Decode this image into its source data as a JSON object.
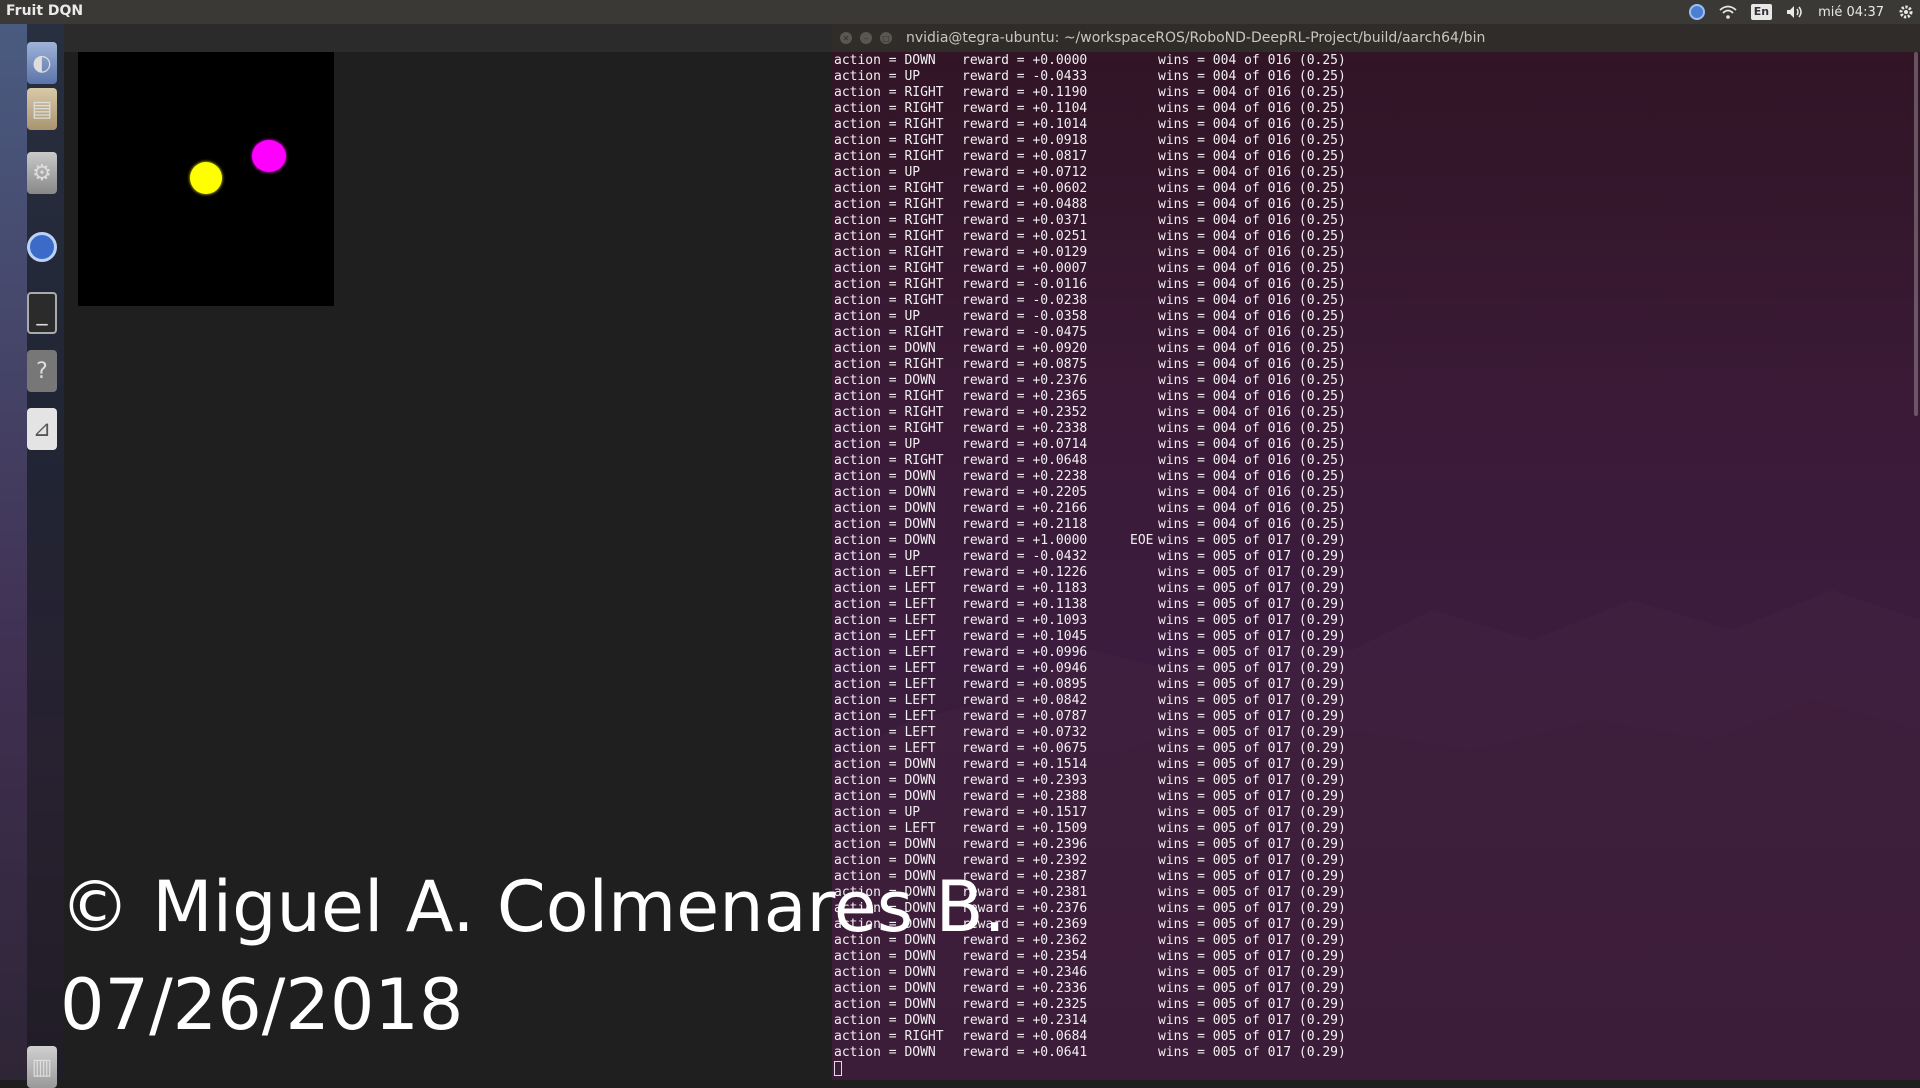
{
  "topbar": {
    "app_title": "Fruit DQN",
    "keyboard_layout": "En",
    "clock": "mié 04:37",
    "icons": [
      "chrome-indicator-icon",
      "wifi-icon",
      "keyboard-layout-icon",
      "volume-icon",
      "gear-icon"
    ]
  },
  "launcher": {
    "icons": [
      "top-launcher-icon",
      "files-icon",
      "settings-icon",
      "chromium-icon",
      "terminal-icon",
      "help-icon",
      "chart-app-icon",
      "trash-icon"
    ]
  },
  "game": {
    "fruit_color": "#ffff00",
    "agent_color": "#ff00ff",
    "background": "#000000"
  },
  "terminal": {
    "title": "nvidia@tegra-ubuntu: ~/workspaceROS/RoboND-DeepRL-Project/build/aarch64/bin",
    "rows": [
      {
        "action": "action = DOWN",
        "reward": "reward = +0.0000",
        "eoe": "",
        "wins": "wins = 004 of 016 (0.25)"
      },
      {
        "action": "action = UP",
        "reward": "reward = -0.0433",
        "eoe": "",
        "wins": "wins = 004 of 016 (0.25)"
      },
      {
        "action": "action = RIGHT",
        "reward": "reward = +0.1190",
        "eoe": "",
        "wins": "wins = 004 of 016 (0.25)"
      },
      {
        "action": "action = RIGHT",
        "reward": "reward = +0.1104",
        "eoe": "",
        "wins": "wins = 004 of 016 (0.25)"
      },
      {
        "action": "action = RIGHT",
        "reward": "reward = +0.1014",
        "eoe": "",
        "wins": "wins = 004 of 016 (0.25)"
      },
      {
        "action": "action = RIGHT",
        "reward": "reward = +0.0918",
        "eoe": "",
        "wins": "wins = 004 of 016 (0.25)"
      },
      {
        "action": "action = RIGHT",
        "reward": "reward = +0.0817",
        "eoe": "",
        "wins": "wins = 004 of 016 (0.25)"
      },
      {
        "action": "action = UP",
        "reward": "reward = +0.0712",
        "eoe": "",
        "wins": "wins = 004 of 016 (0.25)"
      },
      {
        "action": "action = RIGHT",
        "reward": "reward = +0.0602",
        "eoe": "",
        "wins": "wins = 004 of 016 (0.25)"
      },
      {
        "action": "action = RIGHT",
        "reward": "reward = +0.0488",
        "eoe": "",
        "wins": "wins = 004 of 016 (0.25)"
      },
      {
        "action": "action = RIGHT",
        "reward": "reward = +0.0371",
        "eoe": "",
        "wins": "wins = 004 of 016 (0.25)"
      },
      {
        "action": "action = RIGHT",
        "reward": "reward = +0.0251",
        "eoe": "",
        "wins": "wins = 004 of 016 (0.25)"
      },
      {
        "action": "action = RIGHT",
        "reward": "reward = +0.0129",
        "eoe": "",
        "wins": "wins = 004 of 016 (0.25)"
      },
      {
        "action": "action = RIGHT",
        "reward": "reward = +0.0007",
        "eoe": "",
        "wins": "wins = 004 of 016 (0.25)"
      },
      {
        "action": "action = RIGHT",
        "reward": "reward = -0.0116",
        "eoe": "",
        "wins": "wins = 004 of 016 (0.25)"
      },
      {
        "action": "action = RIGHT",
        "reward": "reward = -0.0238",
        "eoe": "",
        "wins": "wins = 004 of 016 (0.25)"
      },
      {
        "action": "action = UP",
        "reward": "reward = -0.0358",
        "eoe": "",
        "wins": "wins = 004 of 016 (0.25)"
      },
      {
        "action": "action = RIGHT",
        "reward": "reward = -0.0475",
        "eoe": "",
        "wins": "wins = 004 of 016 (0.25)"
      },
      {
        "action": "action = DOWN",
        "reward": "reward = +0.0920",
        "eoe": "",
        "wins": "wins = 004 of 016 (0.25)"
      },
      {
        "action": "action = RIGHT",
        "reward": "reward = +0.0875",
        "eoe": "",
        "wins": "wins = 004 of 016 (0.25)"
      },
      {
        "action": "action = DOWN",
        "reward": "reward = +0.2376",
        "eoe": "",
        "wins": "wins = 004 of 016 (0.25)"
      },
      {
        "action": "action = RIGHT",
        "reward": "reward = +0.2365",
        "eoe": "",
        "wins": "wins = 004 of 016 (0.25)"
      },
      {
        "action": "action = RIGHT",
        "reward": "reward = +0.2352",
        "eoe": "",
        "wins": "wins = 004 of 016 (0.25)"
      },
      {
        "action": "action = RIGHT",
        "reward": "reward = +0.2338",
        "eoe": "",
        "wins": "wins = 004 of 016 (0.25)"
      },
      {
        "action": "action = UP",
        "reward": "reward = +0.0714",
        "eoe": "",
        "wins": "wins = 004 of 016 (0.25)"
      },
      {
        "action": "action = RIGHT",
        "reward": "reward = +0.0648",
        "eoe": "",
        "wins": "wins = 004 of 016 (0.25)"
      },
      {
        "action": "action = DOWN",
        "reward": "reward = +0.2238",
        "eoe": "",
        "wins": "wins = 004 of 016 (0.25)"
      },
      {
        "action": "action = DOWN",
        "reward": "reward = +0.2205",
        "eoe": "",
        "wins": "wins = 004 of 016 (0.25)"
      },
      {
        "action": "action = DOWN",
        "reward": "reward = +0.2166",
        "eoe": "",
        "wins": "wins = 004 of 016 (0.25)"
      },
      {
        "action": "action = DOWN",
        "reward": "reward = +0.2118",
        "eoe": "",
        "wins": "wins = 004 of 016 (0.25)"
      },
      {
        "action": "action = DOWN",
        "reward": "reward = +1.0000",
        "eoe": "EOE",
        "wins": "wins = 005 of 017 (0.29)"
      },
      {
        "action": "action = UP",
        "reward": "reward = -0.0432",
        "eoe": "",
        "wins": "wins = 005 of 017 (0.29)"
      },
      {
        "action": "action = LEFT",
        "reward": "reward = +0.1226",
        "eoe": "",
        "wins": "wins = 005 of 017 (0.29)"
      },
      {
        "action": "action = LEFT",
        "reward": "reward = +0.1183",
        "eoe": "",
        "wins": "wins = 005 of 017 (0.29)"
      },
      {
        "action": "action = LEFT",
        "reward": "reward = +0.1138",
        "eoe": "",
        "wins": "wins = 005 of 017 (0.29)"
      },
      {
        "action": "action = LEFT",
        "reward": "reward = +0.1093",
        "eoe": "",
        "wins": "wins = 005 of 017 (0.29)"
      },
      {
        "action": "action = LEFT",
        "reward": "reward = +0.1045",
        "eoe": "",
        "wins": "wins = 005 of 017 (0.29)"
      },
      {
        "action": "action = LEFT",
        "reward": "reward = +0.0996",
        "eoe": "",
        "wins": "wins = 005 of 017 (0.29)"
      },
      {
        "action": "action = LEFT",
        "reward": "reward = +0.0946",
        "eoe": "",
        "wins": "wins = 005 of 017 (0.29)"
      },
      {
        "action": "action = LEFT",
        "reward": "reward = +0.0895",
        "eoe": "",
        "wins": "wins = 005 of 017 (0.29)"
      },
      {
        "action": "action = LEFT",
        "reward": "reward = +0.0842",
        "eoe": "",
        "wins": "wins = 005 of 017 (0.29)"
      },
      {
        "action": "action = LEFT",
        "reward": "reward = +0.0787",
        "eoe": "",
        "wins": "wins = 005 of 017 (0.29)"
      },
      {
        "action": "action = LEFT",
        "reward": "reward = +0.0732",
        "eoe": "",
        "wins": "wins = 005 of 017 (0.29)"
      },
      {
        "action": "action = LEFT",
        "reward": "reward = +0.0675",
        "eoe": "",
        "wins": "wins = 005 of 017 (0.29)"
      },
      {
        "action": "action = DOWN",
        "reward": "reward = +0.1514",
        "eoe": "",
        "wins": "wins = 005 of 017 (0.29)"
      },
      {
        "action": "action = DOWN",
        "reward": "reward = +0.2393",
        "eoe": "",
        "wins": "wins = 005 of 017 (0.29)"
      },
      {
        "action": "action = DOWN",
        "reward": "reward = +0.2388",
        "eoe": "",
        "wins": "wins = 005 of 017 (0.29)"
      },
      {
        "action": "action = UP",
        "reward": "reward = +0.1517",
        "eoe": "",
        "wins": "wins = 005 of 017 (0.29)"
      },
      {
        "action": "action = LEFT",
        "reward": "reward = +0.1509",
        "eoe": "",
        "wins": "wins = 005 of 017 (0.29)"
      },
      {
        "action": "action = DOWN",
        "reward": "reward = +0.2396",
        "eoe": "",
        "wins": "wins = 005 of 017 (0.29)"
      },
      {
        "action": "action = DOWN",
        "reward": "reward = +0.2392",
        "eoe": "",
        "wins": "wins = 005 of 017 (0.29)"
      },
      {
        "action": "action = DOWN",
        "reward": "reward = +0.2387",
        "eoe": "",
        "wins": "wins = 005 of 017 (0.29)"
      },
      {
        "action": "action = DOWN",
        "reward": "reward = +0.2381",
        "eoe": "",
        "wins": "wins = 005 of 017 (0.29)"
      },
      {
        "action": "action = DOWN",
        "reward": "reward = +0.2376",
        "eoe": "",
        "wins": "wins = 005 of 017 (0.29)"
      },
      {
        "action": "action = DOWN",
        "reward": "reward = +0.2369",
        "eoe": "",
        "wins": "wins = 005 of 017 (0.29)"
      },
      {
        "action": "action = DOWN",
        "reward": "reward = +0.2362",
        "eoe": "",
        "wins": "wins = 005 of 017 (0.29)"
      },
      {
        "action": "action = DOWN",
        "reward": "reward = +0.2354",
        "eoe": "",
        "wins": "wins = 005 of 017 (0.29)"
      },
      {
        "action": "action = DOWN",
        "reward": "reward = +0.2346",
        "eoe": "",
        "wins": "wins = 005 of 017 (0.29)"
      },
      {
        "action": "action = DOWN",
        "reward": "reward = +0.2336",
        "eoe": "",
        "wins": "wins = 005 of 017 (0.29)"
      },
      {
        "action": "action = DOWN",
        "reward": "reward = +0.2325",
        "eoe": "",
        "wins": "wins = 005 of 017 (0.29)"
      },
      {
        "action": "action = DOWN",
        "reward": "reward = +0.2314",
        "eoe": "",
        "wins": "wins = 005 of 017 (0.29)"
      },
      {
        "action": "action = RIGHT",
        "reward": "reward = +0.0684",
        "eoe": "",
        "wins": "wins = 005 of 017 (0.29)"
      },
      {
        "action": "action = DOWN",
        "reward": "reward = +0.0641",
        "eoe": "",
        "wins": "wins = 005 of 017 (0.29)"
      }
    ]
  },
  "watermark": {
    "line1": "© Miguel A. Colmenares B.",
    "line2": "07/26/2018"
  }
}
